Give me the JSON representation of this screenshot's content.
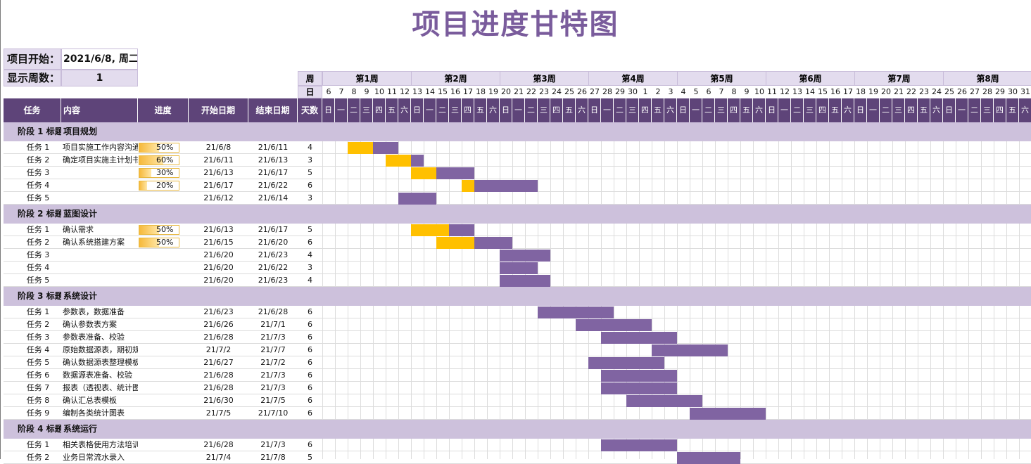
{
  "title": "项目进度甘特图",
  "params": {
    "start_label": "项目开始：",
    "start_value": "2021/6/8, 周二",
    "weeks_label": "显示周数：",
    "weeks_value": "1"
  },
  "header": {
    "week_row_label": "周",
    "day_row_label": "日",
    "columns": {
      "task": "任务",
      "content": "内容",
      "progress": "进度",
      "start": "开始日期",
      "end": "结束日期",
      "days": "天数"
    }
  },
  "weeks": [
    "第1周",
    "第2周",
    "第3周",
    "第4周",
    "第5周",
    "第6周",
    "第7周",
    "第8周"
  ],
  "day_numbers": [
    "6",
    "7",
    "8",
    "9",
    "10",
    "11",
    "12",
    "13",
    "14",
    "15",
    "16",
    "17",
    "18",
    "19",
    "20",
    "21",
    "22",
    "23",
    "24",
    "25",
    "26",
    "27",
    "28",
    "29",
    "30",
    "1",
    "2",
    "3",
    "4",
    "5",
    "6",
    "7",
    "8",
    "9",
    "10",
    "11",
    "12",
    "13",
    "14",
    "15",
    "16",
    "17",
    "18",
    "19",
    "20",
    "21",
    "22",
    "23",
    "24",
    "25",
    "26",
    "27",
    "28",
    "29",
    "30",
    "31"
  ],
  "weekdays": [
    "日",
    "一",
    "二",
    "三",
    "四",
    "五",
    "六"
  ],
  "colors": {
    "title": "#7a5c9c",
    "header": "#5e4479",
    "phase": "#cdc1dc",
    "bar_done": "#ffc000",
    "bar_todo": "#8064a2"
  },
  "phases": [
    {
      "label": "阶段 1 标题",
      "title": "项目规划",
      "tasks": [
        {
          "task": "任务 1",
          "content": "项目实施工作内容沟通",
          "progress": 0.5,
          "progress_text": "50%",
          "start": "21/6/8",
          "end": "21/6/11",
          "days": "4"
        },
        {
          "task": "任务 2",
          "content": "确定项目实施主计划书",
          "progress": 0.6,
          "progress_text": "60%",
          "start": "21/6/11",
          "end": "21/6/13",
          "days": "3"
        },
        {
          "task": "任务 3",
          "content": "",
          "progress": 0.3,
          "progress_text": "30%",
          "start": "21/6/13",
          "end": "21/6/17",
          "days": "5"
        },
        {
          "task": "任务 4",
          "content": "",
          "progress": 0.2,
          "progress_text": "20%",
          "start": "21/6/17",
          "end": "21/6/22",
          "days": "6"
        },
        {
          "task": "任务 5",
          "content": "",
          "progress": 0,
          "progress_text": "",
          "start": "21/6/12",
          "end": "21/6/14",
          "days": "3"
        }
      ]
    },
    {
      "label": "阶段 2 标题",
      "title": "蓝图设计",
      "tasks": [
        {
          "task": "任务 1",
          "content": "确认需求",
          "progress": 0.5,
          "progress_text": "50%",
          "start": "21/6/13",
          "end": "21/6/17",
          "days": "5"
        },
        {
          "task": "任务 2",
          "content": "确认系统搭建方案",
          "progress": 0.5,
          "progress_text": "50%",
          "start": "21/6/15",
          "end": "21/6/20",
          "days": "6"
        },
        {
          "task": "任务 3",
          "content": "",
          "progress": 0,
          "progress_text": "",
          "start": "21/6/20",
          "end": "21/6/23",
          "days": "4"
        },
        {
          "task": "任务 4",
          "content": "",
          "progress": 0,
          "progress_text": "",
          "start": "21/6/20",
          "end": "21/6/22",
          "days": "3"
        },
        {
          "task": "任务 5",
          "content": "",
          "progress": 0,
          "progress_text": "",
          "start": "21/6/20",
          "end": "21/6/23",
          "days": "4"
        }
      ]
    },
    {
      "label": "阶段 3 标题",
      "title": "系统设计",
      "tasks": [
        {
          "task": "任务 1",
          "content": "参数表，数据准备",
          "progress": 0,
          "progress_text": "",
          "start": "21/6/23",
          "end": "21/6/28",
          "days": "6"
        },
        {
          "task": "任务 2",
          "content": "确认参数表方案",
          "progress": 0,
          "progress_text": "",
          "start": "21/6/26",
          "end": "21/7/1",
          "days": "6"
        },
        {
          "task": "任务 3",
          "content": "参数表准备、校验",
          "progress": 0,
          "progress_text": "",
          "start": "21/6/28",
          "end": "21/7/3",
          "days": "6"
        },
        {
          "task": "任务 4",
          "content": "原始数据源表，期初规范化",
          "progress": 0,
          "progress_text": "",
          "start": "21/7/2",
          "end": "21/7/7",
          "days": "6"
        },
        {
          "task": "任务 5",
          "content": "确认数据源表整理模板",
          "progress": 0,
          "progress_text": "",
          "start": "21/6/27",
          "end": "21/7/2",
          "days": "6"
        },
        {
          "task": "任务 6",
          "content": "数据源表准备、校验",
          "progress": 0,
          "progress_text": "",
          "start": "21/6/28",
          "end": "21/7/3",
          "days": "6"
        },
        {
          "task": "任务 7",
          "content": "报表（透视表、统计图表）编制",
          "progress": 0,
          "progress_text": "",
          "start": "21/6/28",
          "end": "21/7/3",
          "days": "6"
        },
        {
          "task": "任务 8",
          "content": "确认汇总表模板",
          "progress": 0,
          "progress_text": "",
          "start": "21/6/30",
          "end": "21/7/5",
          "days": "6"
        },
        {
          "task": "任务 9",
          "content": "编制各类统计图表",
          "progress": 0,
          "progress_text": "",
          "start": "21/7/5",
          "end": "21/7/10",
          "days": "6"
        }
      ]
    },
    {
      "label": "阶段 4 标题",
      "title": "系统运行",
      "tasks": [
        {
          "task": "任务 1",
          "content": "相关表格使用方法培训",
          "progress": 0,
          "progress_text": "",
          "start": "21/6/28",
          "end": "21/7/3",
          "days": "6"
        },
        {
          "task": "任务 2",
          "content": "业务日常流水录入",
          "progress": 0,
          "progress_text": "",
          "start": "21/7/4",
          "end": "21/7/8",
          "days": "5"
        }
      ]
    }
  ]
}
